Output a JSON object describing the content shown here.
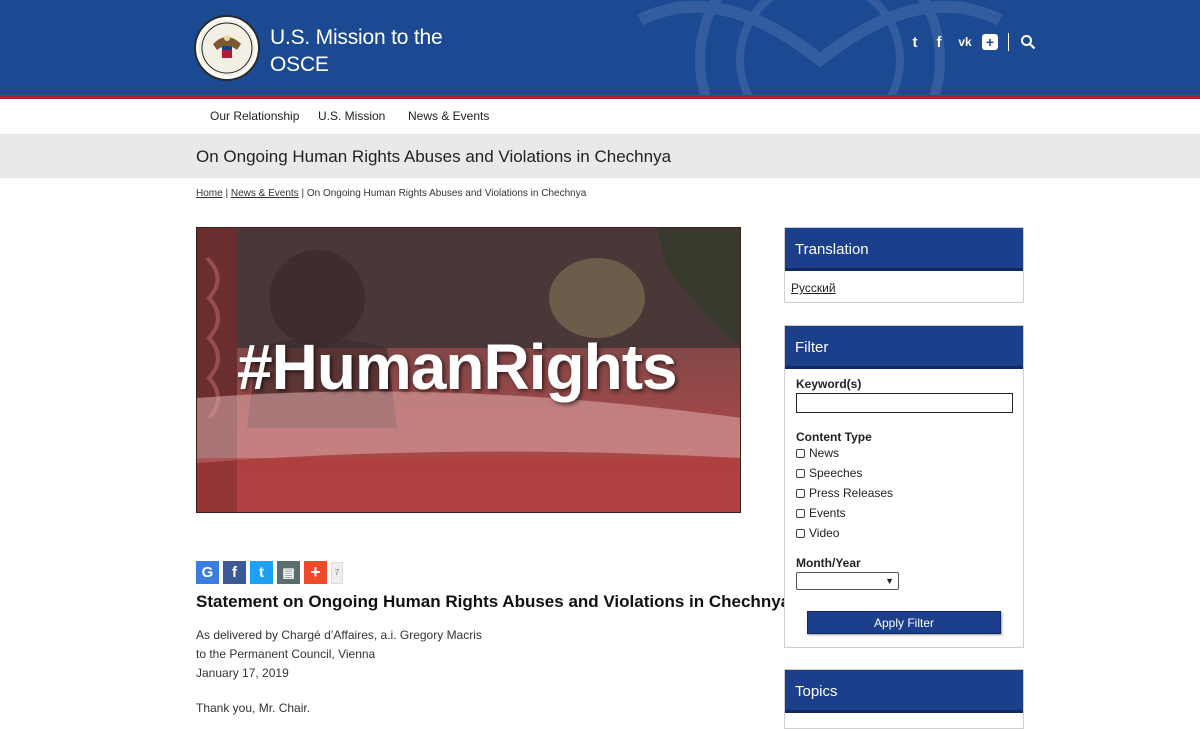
{
  "header": {
    "title_line1": "U.S. Mission to the",
    "title_line2": "OSCE",
    "social": {
      "twitter_glyph": "t",
      "facebook_glyph": "f",
      "vk_glyph": "vk",
      "addthis_glyph": "+",
      "search_glyph": "⌕"
    }
  },
  "nav": {
    "items": [
      {
        "label": "Our Relationship"
      },
      {
        "label": "U.S. Mission"
      },
      {
        "label": "News & Events"
      }
    ]
  },
  "page_title": "On Ongoing Human Rights Abuses and Violations in Chechnya",
  "breadcrumb": {
    "home": "Home",
    "sep1": "|",
    "news": "News & Events",
    "sep2": "|",
    "current": "On Ongoing Human Rights Abuses and Violations in Chechnya"
  },
  "hero": {
    "text": "#HumanRights"
  },
  "share": {
    "google": "G",
    "facebook": "f",
    "twitter": "t",
    "print": "▤",
    "more": "+",
    "count": "7"
  },
  "article": {
    "title": "Statement on Ongoing Human Rights Abuses and Violations in Chechnya",
    "line1": "As delivered by Chargé d’Affaires, a.i. Gregory Macris",
    "line2": "to the Permanent Council, Vienna",
    "date": "January 17, 2019",
    "opening": "Thank you, Mr. Chair."
  },
  "sidebar": {
    "translation": {
      "heading": "Translation",
      "link": "Русский"
    },
    "filter": {
      "heading": "Filter",
      "keyword_label": "Keyword(s)",
      "content_type_label": "Content Type",
      "types": [
        "News",
        "Speeches",
        "Press Releases",
        "Events",
        "Video"
      ],
      "month_year_label": "Month/Year",
      "apply_label": "Apply Filter"
    },
    "topics": {
      "heading": "Topics"
    }
  },
  "colors": {
    "header_blue": "#1b4a93",
    "accent_red": "#b31b34",
    "panel_blue": "#1b3f8a"
  }
}
